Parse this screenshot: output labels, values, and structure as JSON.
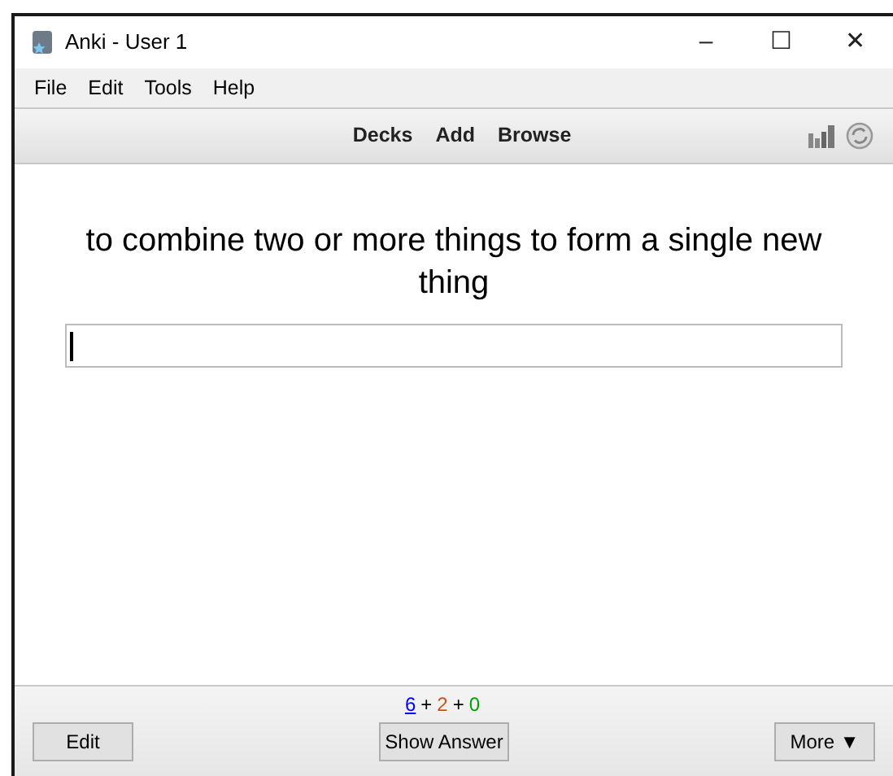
{
  "window": {
    "title": "Anki - User 1",
    "controls": [
      "–",
      "☐",
      "✕"
    ]
  },
  "menu": [
    "File",
    "Edit",
    "Tools",
    "Help"
  ],
  "toolbar": {
    "links": [
      "Decks",
      "Add",
      "Browse"
    ]
  },
  "card": {
    "question": "to combine two or more things to form a single new thing"
  },
  "counts": [
    {
      "value": "6",
      "color": "#0000ff",
      "current": true
    },
    {
      "sep": "+",
      "value": "2",
      "color": "#c35617",
      "current": false
    },
    {
      "sep": "+",
      "value": "0",
      "color": "#00a000",
      "current": false
    }
  ],
  "buttons": {
    "left": "Edit",
    "center": "Show Answer",
    "right": "More ▼"
  }
}
